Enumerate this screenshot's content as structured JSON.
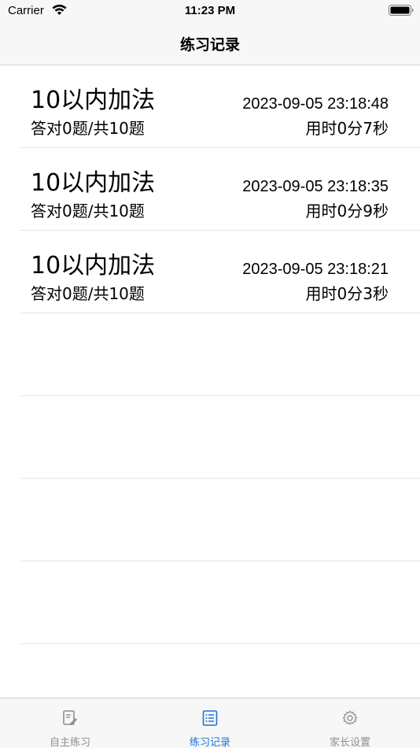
{
  "status_bar": {
    "carrier": "Carrier",
    "time": "11:23 PM"
  },
  "nav": {
    "title": "练习记录"
  },
  "records": [
    {
      "title": "10以内加法",
      "time": "2023-09-05 23:18:48",
      "score": "答对0题/共10题",
      "duration": "用时0分7秒"
    },
    {
      "title": "10以内加法",
      "time": "2023-09-05 23:18:35",
      "score": "答对0题/共10题",
      "duration": "用时0分9秒"
    },
    {
      "title": "10以内加法",
      "time": "2023-09-05 23:18:21",
      "score": "答对0题/共10题",
      "duration": "用时0分3秒"
    }
  ],
  "tabs": [
    {
      "label": "自主练习",
      "icon": "edit-document-icon",
      "active": false
    },
    {
      "label": "练习记录",
      "icon": "list-icon",
      "active": true
    },
    {
      "label": "家长设置",
      "icon": "gear-icon",
      "active": false
    }
  ],
  "colors": {
    "accent": "#1a73d9",
    "inactive": "#8e8e93"
  }
}
